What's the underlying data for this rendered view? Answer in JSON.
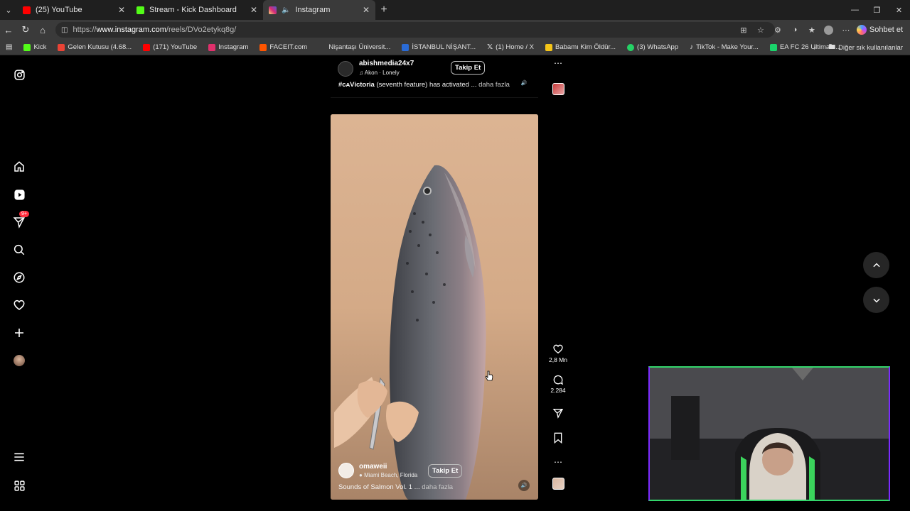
{
  "browser": {
    "tabs": [
      {
        "label": "(25) YouTube",
        "favicon_color": "#ff0000",
        "icon": "youtube-icon",
        "active": false
      },
      {
        "label": "Stream - Kick Dashboard",
        "favicon_color": "#53fc18",
        "icon": "kick-icon",
        "active": false
      },
      {
        "label": "Instagram",
        "favicon_color": "#e1306c",
        "icon": "instagram-icon",
        "active": true
      }
    ],
    "url_prefix": "https://",
    "url_host": "www.instagram.com",
    "url_path": "/reels/DVo2etykq8g/",
    "copilot_label": "Sohbet et",
    "bookmarks": [
      {
        "label": "Kick",
        "color": "#53fc18"
      },
      {
        "label": "Gelen Kutusu (4.68...",
        "color": "#ea4335"
      },
      {
        "label": "(171) YouTube",
        "color": "#ff0000"
      },
      {
        "label": "Instagram",
        "color": "#e1306c"
      },
      {
        "label": "FACEIT.com",
        "color": "#ff5500"
      },
      {
        "label": "Nişantaşı Üniversit...",
        "color": "#3a3a3a"
      },
      {
        "label": "İSTANBUL NİŞANT...",
        "color": "#2a6bd6"
      },
      {
        "label": "(1) Home / X",
        "color": "#ffffff"
      },
      {
        "label": "Babamı Kim Öldür...",
        "color": "#f5c518"
      },
      {
        "label": "(3) WhatsApp",
        "color": "#25d366"
      },
      {
        "label": "TikTok - Make Your...",
        "color": "#111111"
      },
      {
        "label": "EA FC 26 Ultimate...",
        "color": "#1ad46b"
      }
    ],
    "other_bookmarks_label": "Diğer sık kullanılanlar"
  },
  "sidebar": {
    "notification_badge": "9+",
    "items": [
      "home-icon",
      "reels-icon",
      "messages-icon",
      "search-icon",
      "explore-icon",
      "notifications-icon",
      "create-icon",
      "profile-avatar"
    ],
    "more_icon": "menu-icon",
    "also_from_meta_icon": "apps-icon"
  },
  "prev_reel": {
    "username": "abishmedia24x7",
    "audio": "Akon · Lonely",
    "follow_label": "Takip Et",
    "caption_tag": "#ᴄᴀVictoria",
    "caption_text": " (seventh feature) has activated ...",
    "more_label": " daha fazla"
  },
  "current_reel": {
    "username": "omaweii",
    "location": "Miami Beach, Florida",
    "follow_label": "Takip Et",
    "caption_text": "Sounds of Salmon Vol. 1 ...",
    "more_label": " daha fazla",
    "likes": "2,8 Mn",
    "comments": "2.284"
  },
  "colors": {
    "accent_badge": "#ff3040",
    "webcam_border_green": "#33d66b",
    "webcam_border_purple": "#7b2bff"
  }
}
